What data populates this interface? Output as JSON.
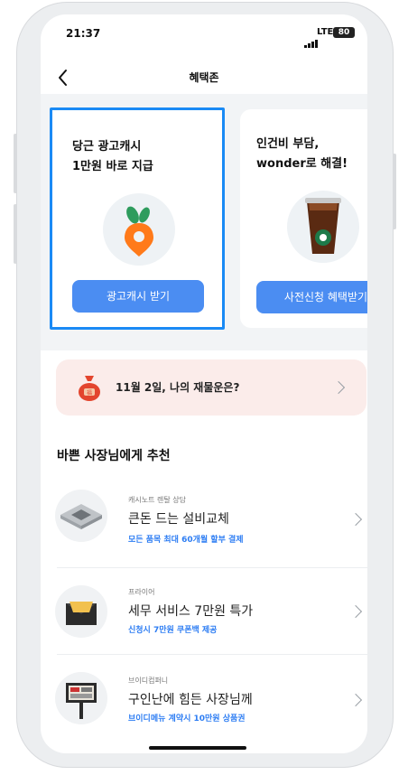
{
  "status": {
    "time": "21:37",
    "network": "LTE",
    "battery": "80"
  },
  "header": {
    "title": "혜택존"
  },
  "cards": [
    {
      "title": "당근 광고캐시\n1만원 바로 지급",
      "button": "광고캐시 받기",
      "icon": "carrot-pin-icon"
    },
    {
      "title": "인건비 부담,\nwonder로 해결!",
      "button": "사전신청 혜택받기",
      "icon": "iced-coffee-icon"
    }
  ],
  "fortune": {
    "text": "11월 2일, 나의 재물운은?",
    "icon": "money-bag-icon"
  },
  "section": {
    "title": "바쁜 사장님에게 추천"
  },
  "items": [
    {
      "provider": "캐시노트 렌탈 상담",
      "title": "큰돈 드는 설비교체",
      "subtitle": "모든 품목 최대 60개월 할부 결제",
      "icon": "ceiling-aircon-icon"
    },
    {
      "provider": "프라이어",
      "title": "세무 서비스 7만원 특가",
      "subtitle": "신청시 7만원 쿠폰백 제공",
      "icon": "envelope-icon"
    },
    {
      "provider": "브이디컴퍼니",
      "title": "구인난에 힘든 사장님께",
      "subtitle": "브이디메뉴 계약시 10만원 상품권",
      "icon": "kiosk-icon"
    }
  ],
  "colors": {
    "accent": "#4b8df2",
    "selection": "#1a8af5",
    "link": "#2d7df3",
    "fortune_bg": "#fbecea"
  }
}
